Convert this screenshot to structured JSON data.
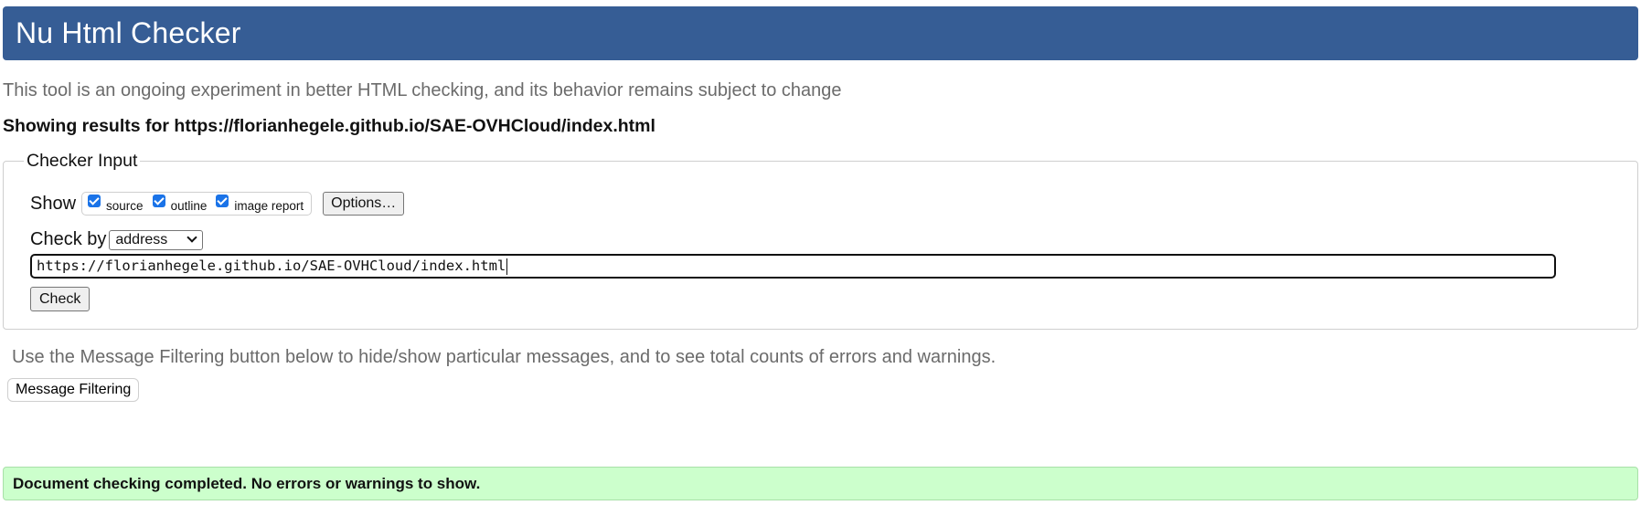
{
  "header": {
    "title": "Nu Html Checker"
  },
  "tagline": "This tool is an ongoing experiment in better HTML checking, and its behavior remains subject to change",
  "results_heading": "Showing results for https://florianhegele.github.io/SAE-OVHCloud/index.html",
  "checker_input": {
    "legend": "Checker Input",
    "show_label": "Show",
    "show_options": [
      {
        "label": "source",
        "checked": true
      },
      {
        "label": "outline",
        "checked": true
      },
      {
        "label": "image report",
        "checked": true
      }
    ],
    "options_button": "Options…",
    "check_by_label": "Check by",
    "check_by_value": "address",
    "url_value": "https://florianhegele.github.io/SAE-OVHCloud/index.html",
    "check_button": "Check"
  },
  "filter_note": "Use the Message Filtering button below to hide/show particular messages, and to see total counts of errors and warnings.",
  "filter_button": "Message Filtering",
  "status_message": "Document checking completed. No errors or warnings to show.",
  "colors": {
    "header_bg": "#365d95",
    "success_bg": "#ccffcc",
    "checkbox": "#1a73e8"
  }
}
